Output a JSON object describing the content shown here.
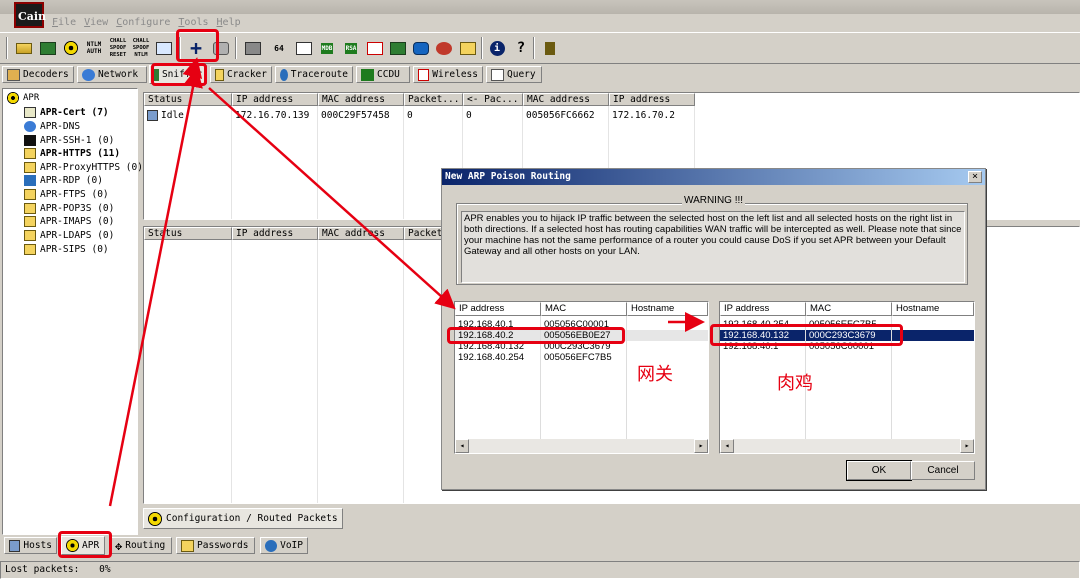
{
  "app": {
    "logo_text": "Cain"
  },
  "menu": [
    "File",
    "View",
    "Configure",
    "Tools",
    "Help"
  ],
  "toolbar": {
    "icons": [
      "open-folder-icon",
      "network-card-icon",
      "apr-radiation-icon",
      "ntlm-auth-icon",
      "challenge-spoof-reset-icon",
      "challenge-spoof-ntlm-icon",
      "monitor-icon",
      "add-to-list-icon",
      "lookup-icon",
      "certificate-icon",
      "base64-icon",
      "hash-icon",
      "mdb-icon",
      "rsa-icon",
      "remote-desktop-icon",
      "voip-icon",
      "key-icon",
      "help-icon",
      "question-icon",
      "tree-icon"
    ],
    "labels": {
      "ntlm": "NTLM AUTH",
      "spoof_reset": "CHALL SPOOF RESET",
      "spoof_ntlm": "CHALL SPOOF NTLM",
      "base64": "64",
      "mdb": "MDB",
      "rsa": "RSA"
    }
  },
  "tabs": [
    "Decoders",
    "Network",
    "Sniffer",
    "Cracker",
    "Traceroute",
    "CCDU",
    "Wireless",
    "Query"
  ],
  "active_tab": "Sniffer",
  "tree": {
    "root": "APR",
    "items": [
      {
        "label": "APR-Cert (7)",
        "bold": true
      },
      {
        "label": "APR-DNS",
        "bold": false
      },
      {
        "label": "APR-SSH-1 (0)",
        "bold": false
      },
      {
        "label": "APR-HTTPS (11)",
        "bold": true
      },
      {
        "label": "APR-ProxyHTTPS (0)",
        "bold": false
      },
      {
        "label": "APR-RDP (0)",
        "bold": false
      },
      {
        "label": "APR-FTPS (0)",
        "bold": false
      },
      {
        "label": "APR-POP3S (0)",
        "bold": false
      },
      {
        "label": "APR-IMAPS (0)",
        "bold": false
      },
      {
        "label": "APR-LDAPS (0)",
        "bold": false
      },
      {
        "label": "APR-SIPS (0)",
        "bold": false
      }
    ]
  },
  "top_grid": {
    "headers": [
      "Status",
      "IP address",
      "MAC address",
      "Packet...",
      "<- Pac...",
      "MAC address",
      "IP address"
    ],
    "rows": [
      [
        "Idle",
        "172.16.70.139",
        "000C29F57458",
        "0",
        "0",
        "005056FC6662",
        "172.16.70.2"
      ]
    ]
  },
  "bottom_grid": {
    "headers": [
      "Status",
      "IP address",
      "MAC address",
      "Packet..."
    ]
  },
  "dialog": {
    "title": "New ARP Poison Routing",
    "close": "×",
    "warning_title": "WARNING !!!",
    "warning_text": "APR enables you to hijack IP traffic between the selected host on the left list and all selected hosts on the right list in both directions. If a selected host has routing capabilities WAN traffic will be intercepted as well. Please note that since your machine has not the same performance of a router you could cause DoS if you set APR between your Default Gateway and all other hosts on your LAN.",
    "headers": [
      "IP address",
      "MAC",
      "Hostname"
    ],
    "left_rows": [
      [
        "192.168.40.1",
        "005056C00001",
        ""
      ],
      [
        "192.168.40.2",
        "005056EB0E27",
        ""
      ],
      [
        "192.168.40.132",
        "000C293C3679",
        ""
      ],
      [
        "192.168.40.254",
        "005056EFC7B5",
        ""
      ]
    ],
    "left_selected": 1,
    "right_rows": [
      [
        "192.168.40.254",
        "005056EFC7B5",
        ""
      ],
      [
        "192.168.40.132",
        "000C293C3679",
        ""
      ],
      [
        "192.168.40.1",
        "005056C00001",
        ""
      ]
    ],
    "right_selected": 1,
    "ok": "OK",
    "cancel": "Cancel"
  },
  "annotations": {
    "gateway": "网关",
    "victim": "肉鸡",
    "color": "#e60012"
  },
  "config_tab": "Configuration / Routed Packets",
  "bottom_tabs": [
    "Hosts",
    "APR",
    "Routing",
    "Passwords",
    "VoIP"
  ],
  "active_bottom_tab": "APR",
  "status": {
    "label": "Lost packets:",
    "value": "0%"
  }
}
